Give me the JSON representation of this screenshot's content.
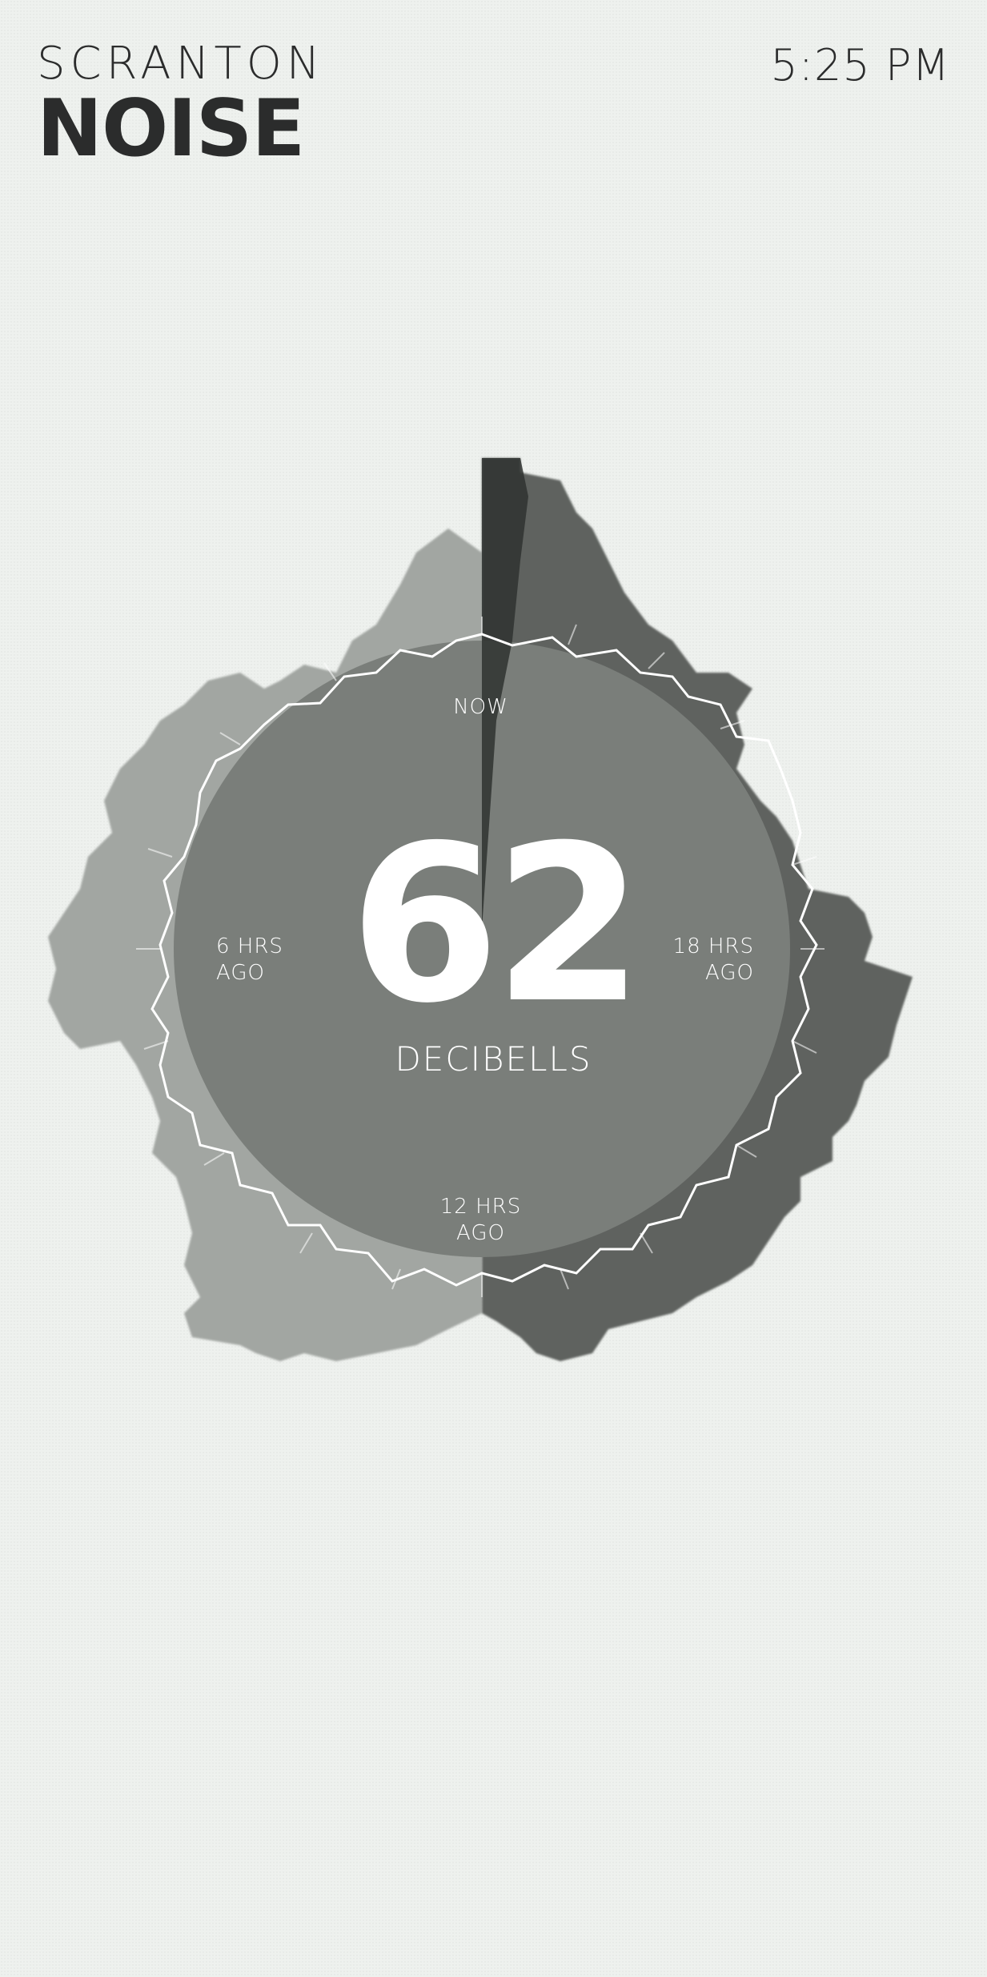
{
  "header": {
    "city": "SCRANTON",
    "title": "NOISE",
    "time": "5:25 PM"
  },
  "gauge": {
    "value": "62",
    "unit": "DECIBELLS",
    "labels": {
      "now": "NOW",
      "six_hrs": [
        "6 HRS",
        "AGO"
      ],
      "twelve_hrs": [
        "12 HRS",
        "AGO"
      ],
      "eighteen_hrs": [
        "18 HRS",
        "AGO"
      ]
    }
  },
  "colors": {
    "background": "#eef1ee",
    "text": "#2b2c2c",
    "dark_sector": "#3d403e",
    "mid_sector": "#7b7f7b",
    "light_sector": "#a7aba7"
  }
}
